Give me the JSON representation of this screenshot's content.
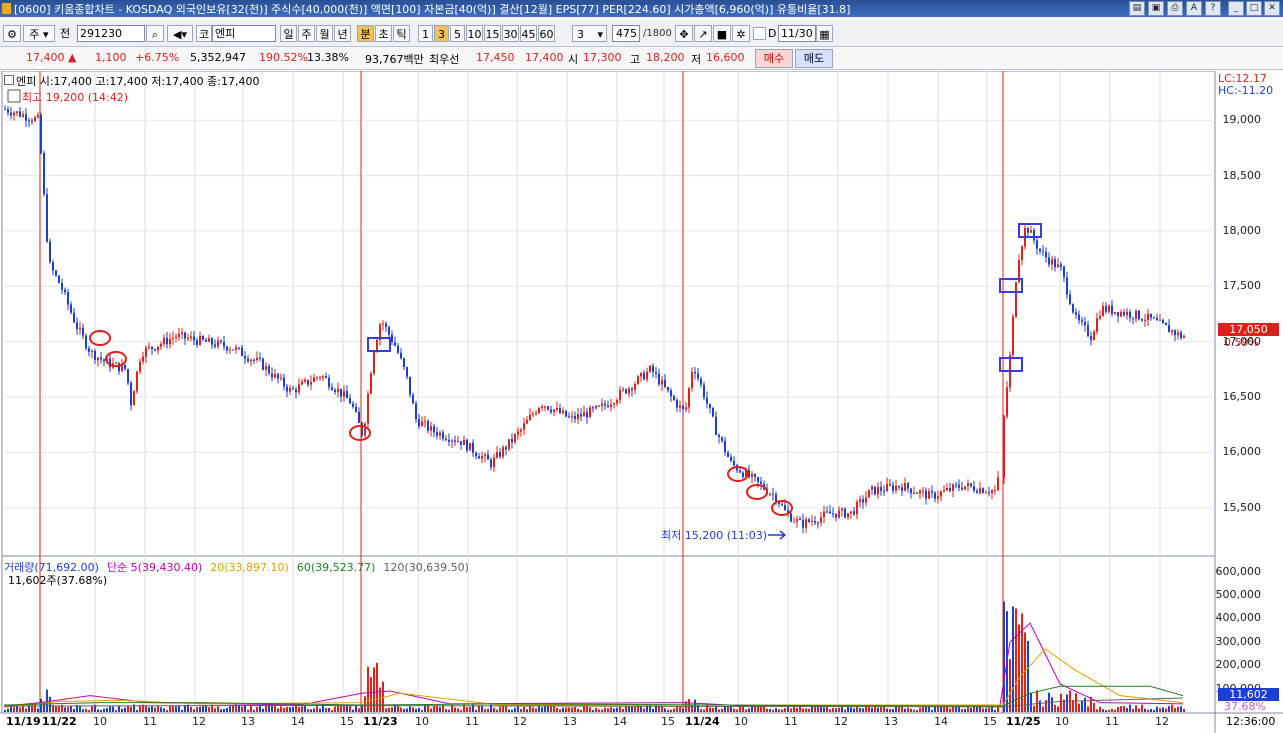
{
  "titlebar": {
    "text": "[0600] 키움종합차트 - KOSDAQ 외국인보유[32(천)] 주식수[40,000(천)] 액면[100] 자본금[40(억)] 결산[12월] EPS[77] PER[224.60] 시가총액[6,960(억)] 유통비율[31.8]"
  },
  "toolbar": {
    "mode": "주",
    "prev_label": "전",
    "code": "291230",
    "market": "코",
    "name": "엔피",
    "periods": [
      "일",
      "주",
      "월",
      "년"
    ],
    "tick_types": [
      "분",
      "초",
      "틱"
    ],
    "minute_options": [
      "1",
      "3",
      "5",
      "10",
      "15",
      "30",
      "45",
      "60"
    ],
    "selected_minute": "3",
    "count": "3",
    "bar_count": "475",
    "bar_total": "/1800",
    "checkbox_label": "D",
    "date": "11/30"
  },
  "quote": {
    "price": "17,400 ▲",
    "change": "1,100",
    "change_pct": "+6.75%",
    "volume": "5,352,947",
    "volume_ratio": "190.52%",
    "turnover": "13.38%",
    "amount": "93,767백만",
    "best_label": "최우선",
    "ask": "17,450",
    "bid": "17,400",
    "open_label": "시",
    "open": "17,300",
    "high_label": "고",
    "high": "18,200",
    "low_label": "저",
    "low": "16,600",
    "buy_button": "매수",
    "sell_button": "매도"
  },
  "price_panel": {
    "info": "엔피 시:17,400 고:17,400 저:17,400 종:17,400",
    "lc": "LC:12.17",
    "hc": "HC:-11.20",
    "high_note": "최고 19,200 (14:42)",
    "low_note": "최저 15,200 (11:03)",
    "last_price": "17,050",
    "last_pct": "0.59%",
    "yticks": [
      "19,000",
      "18,500",
      "18,000",
      "17,500",
      "17,000",
      "16,500",
      "16,000",
      "15,500"
    ]
  },
  "volume_panel": {
    "legend": [
      "거래량(71,692.00)",
      "단순 5(39,430.40)",
      "20(33,897.10)",
      "60(39,523.77)",
      "120(30,639.50)"
    ],
    "legend_colors": [
      "#1d3fd1",
      "#c000c0",
      "#e0a000",
      "#208020",
      "#606060"
    ],
    "current": "11,602주(37.68%)",
    "yticks": [
      "600,000",
      "500,000",
      "400,000",
      "300,000",
      "200,000",
      "100,000"
    ],
    "last_value": "11,602",
    "last_pct": "37.68%"
  },
  "x_axis": {
    "labels": [
      "11/19",
      "11/22",
      "10",
      "11",
      "12",
      "13",
      "14",
      "15",
      "11/23",
      "10",
      "11",
      "12",
      "13",
      "14",
      "15",
      "11/24",
      "10",
      "11",
      "12",
      "13",
      "14",
      "15",
      "11/25",
      "10",
      "11",
      "12"
    ],
    "bold_labels": [
      "11/19",
      "11/22",
      "11/23",
      "11/24",
      "11/25"
    ],
    "time": "12:36:00"
  },
  "chart_data": {
    "type": "candlestick",
    "interval": "3-minute",
    "ylim": [
      15100,
      19300
    ],
    "series": [
      {
        "x": "11/19",
        "close": 19000
      },
      {
        "x": "11/22 09:00",
        "close": 18400
      },
      {
        "x": "11/22 09:30",
        "close": 17200
      },
      {
        "x": "11/22 10:00",
        "close": 16900
      },
      {
        "x": "11/22 11:00",
        "close": 17050
      },
      {
        "x": "11/22 12:00",
        "close": 17000
      },
      {
        "x": "11/22 13:00",
        "close": 16750
      },
      {
        "x": "11/22 14:00",
        "close": 16650
      },
      {
        "x": "11/22 15:00",
        "close": 16550
      },
      {
        "x": "11/22 15:20",
        "close": 16100
      },
      {
        "x": "11/23 09:10",
        "close": 17200
      },
      {
        "x": "11/23 10:00",
        "close": 16400
      },
      {
        "x": "11/23 11:00",
        "close": 16200
      },
      {
        "x": "11/23 12:00",
        "close": 15900
      },
      {
        "x": "11/23 13:00",
        "close": 16450
      },
      {
        "x": "11/23 14:00",
        "close": 16400
      },
      {
        "x": "11/23 15:00",
        "close": 16750
      },
      {
        "x": "11/23 15:20",
        "close": 16600
      },
      {
        "x": "11/24 09:10",
        "close": 16800
      },
      {
        "x": "11/24 10:00",
        "close": 16100
      },
      {
        "x": "11/24 11:00",
        "close": 15350
      },
      {
        "x": "11/24 12:00",
        "close": 15400
      },
      {
        "x": "11/24 13:00",
        "close": 15650
      },
      {
        "x": "11/24 14:00",
        "close": 15700
      },
      {
        "x": "11/24 15:20",
        "close": 15650
      },
      {
        "x": "11/25 09:00",
        "close": 16700
      },
      {
        "x": "11/25 09:30",
        "close": 17950
      },
      {
        "x": "11/25 10:00",
        "close": 17750
      },
      {
        "x": "11/25 11:00",
        "close": 17000
      },
      {
        "x": "11/25 12:00",
        "close": 17150
      },
      {
        "x": "11/25 12:36",
        "close": 17050
      }
    ],
    "annotations": {
      "high": "최고 19,200 (14:42)",
      "low": "최저 15,200 (11:03)"
    }
  },
  "colors": {
    "up": "#e0201a",
    "down": "#1d3fd1",
    "title_bg": "#2a4f95",
    "selected": "#f3c058"
  }
}
